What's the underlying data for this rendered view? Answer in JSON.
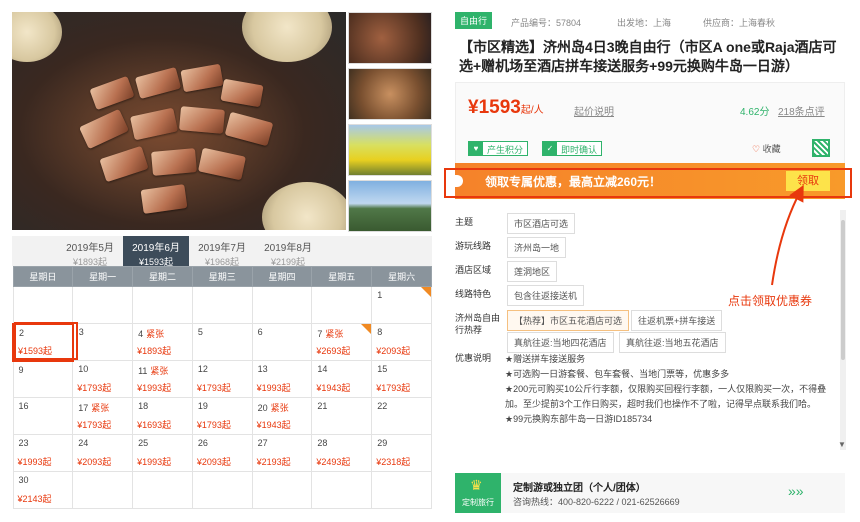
{
  "gallery": {
    "main_alt": "烤五花肉",
    "thumbs": [
      "烤肉",
      "拌饭",
      "油菜花",
      "海岸"
    ]
  },
  "months": [
    {
      "label": "2019年5月",
      "price": "¥1893起"
    },
    {
      "label": "2019年6月",
      "price": "¥1593起"
    },
    {
      "label": "2019年7月",
      "price": "¥1968起"
    },
    {
      "label": "2019年8月",
      "price": "¥2199起"
    }
  ],
  "weekdays": [
    "星期日",
    "星期一",
    "星期二",
    "星期三",
    "星期四",
    "星期五",
    "星期六"
  ],
  "calendar": [
    [
      {
        "d": ""
      },
      {
        "d": ""
      },
      {
        "d": ""
      },
      {
        "d": ""
      },
      {
        "d": ""
      },
      {
        "d": ""
      },
      {
        "d": "1",
        "corner": true
      }
    ],
    [
      {
        "d": "2",
        "p": "¥1593起",
        "sel": true
      },
      {
        "d": "3"
      },
      {
        "d": "4",
        "t": "紧张",
        "p": "¥1893起"
      },
      {
        "d": "5"
      },
      {
        "d": "6"
      },
      {
        "d": "7",
        "t": "紧张",
        "p": "¥2693起",
        "corner": true
      },
      {
        "d": "8",
        "p": "¥2093起"
      }
    ],
    [
      {
        "d": "9"
      },
      {
        "d": "10",
        "p": "¥1793起"
      },
      {
        "d": "11",
        "t": "紧张",
        "p": "¥1993起"
      },
      {
        "d": "12",
        "p": "¥1793起"
      },
      {
        "d": "13",
        "p": "¥1993起"
      },
      {
        "d": "14",
        "p": "¥1943起"
      },
      {
        "d": "15",
        "p": "¥1793起"
      }
    ],
    [
      {
        "d": "16"
      },
      {
        "d": "17",
        "t": "紧张",
        "p": "¥1793起"
      },
      {
        "d": "18",
        "p": "¥1693起"
      },
      {
        "d": "19",
        "p": "¥1793起"
      },
      {
        "d": "20",
        "t": "紧张",
        "p": "¥1943起"
      },
      {
        "d": "21"
      },
      {
        "d": "22"
      }
    ],
    [
      {
        "d": "23",
        "p": "¥1993起"
      },
      {
        "d": "24",
        "p": "¥2093起"
      },
      {
        "d": "25",
        "p": "¥1993起"
      },
      {
        "d": "26",
        "p": "¥2093起"
      },
      {
        "d": "27",
        "p": "¥2193起"
      },
      {
        "d": "28",
        "p": "¥2493起"
      },
      {
        "d": "29",
        "p": "¥2318起"
      }
    ],
    [
      {
        "d": "30",
        "p": "¥2143起"
      },
      {
        "d": ""
      },
      {
        "d": ""
      },
      {
        "d": ""
      },
      {
        "d": ""
      },
      {
        "d": ""
      },
      {
        "d": ""
      }
    ]
  ],
  "meta": {
    "badge": "自由行",
    "code": "产品编号：57804",
    "from": "出发地：上海",
    "supplier": "供应商：上海春秋"
  },
  "title": "【市区精选】济州岛4日3晚自由行（市区A one或Raja酒店可选+赠机场至酒店拼车接送服务+99元换购牛岛一日游）",
  "price": {
    "amount": "¥1593",
    "unit": "起/人",
    "explain": "起价说明",
    "score": "4.62分",
    "reviews": "218条点评"
  },
  "chips": {
    "points": "产生积分",
    "confirm": "即时确认",
    "fav": "收藏"
  },
  "promo": {
    "text": "领取专属优惠，最高立减260元！",
    "button": "领取"
  },
  "details": {
    "theme_k": "主题",
    "theme": "市区酒店可选",
    "route_k": "游玩线路",
    "route": "济州岛一地",
    "area_k": "酒店区域",
    "area": "莲洞地区",
    "feature_k": "线路特色",
    "feature": "包含往返接送机",
    "hot_k": "济州岛自由行热荐",
    "hot": [
      "【热荐】市区五花酒店可选",
      "往返机票+拼车接送",
      "真航往返:当地四花酒店",
      "真航往返:当地五花酒店"
    ],
    "offer_k": "优惠说明",
    "offer": [
      "★赠送拼车接送服务",
      "★可选购一日游套餐、包车套餐、当地门票等，优惠多多",
      "★200元可购买10公斤行李额，仅限购买回程行李额，一人仅限购买一次，不得叠加。至少提前3个工作日购买，超时我们也操作不了啦，记得早点联系我们哈。",
      "★99元换购东部牛岛一日游ID185734"
    ]
  },
  "custom": {
    "logo": "定制旅行",
    "title": "定制游或独立团（个人/团体）",
    "hotline": "咨询热线：400-820-6222 / 021-62526669"
  },
  "annotation": "点击领取优惠券"
}
